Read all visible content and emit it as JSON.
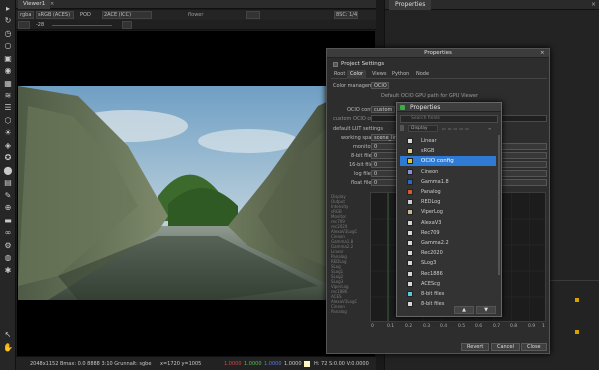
{
  "viewer": {
    "tab_label": "Viewer1",
    "header": {
      "channels": "rgba",
      "colorspace": "sRGB (ACES)",
      "flag": "POD",
      "display": "2ACE (ICC)",
      "frame_mode": "flower",
      "sampling": "8SC: 1/4",
      "gain_value": "-28"
    },
    "footer": {
      "format": "2048x1152 Bmax: 0.0 8888 3:10 Grunnalt: sgbe",
      "coords": "x=1720 y=1005",
      "r": "1.0000",
      "g": "1.0000",
      "b": "1.0000",
      "a": "1.0000",
      "extra": "H: 72 S:0.00 V:0.0000"
    }
  },
  "right_panel": {
    "tab_label": "Properties"
  },
  "properties_window": {
    "title": "Properties",
    "section_title": "Project Settings",
    "tabs": [
      "Root",
      "Color",
      "Views",
      "Python",
      "Node"
    ],
    "active_tab": "Color",
    "fields": {
      "color_management_label": "Color management",
      "color_management_value": "OCIO",
      "ocio_note": "Default OCIO GPU path for GPU Viewer",
      "ocio_config_label": "OCIO config",
      "ocio_config_value": "custom",
      "custom_ocio_label": "custom OCIO config",
      "default_lut_label": "default LUT settings",
      "working_space_label": "working space",
      "working_space_value": "scene_linear",
      "monitor_label": "monitor",
      "monitor_value": "0",
      "8bit_label": "8-bit files",
      "8bit_value": "0",
      "16bit_label": "16-bit files",
      "16bit_value": "0",
      "log_label": "log files",
      "log_value": "0",
      "float_label": "float files",
      "float_value": "0"
    },
    "curve_labels": [
      "Display",
      "Output",
      "Intensity",
      "sRGB",
      "Monitor",
      "rec709",
      "rec2020",
      "AlexaV3LogC",
      "Cineon",
      "Gamma1.8",
      "Gamma2.2",
      "Linear",
      "Panalog",
      "REDLog",
      "SLog",
      "SLog1",
      "SLog2",
      "SLog3",
      "ViperLog",
      "rec1886",
      "ACES",
      "AlexaV3LogC",
      "Cineon",
      "Panalog"
    ],
    "x_axis": [
      "0",
      "0.1",
      "0.2",
      "0.3",
      "0.4",
      "0.5",
      "0.6",
      "0.7",
      "0.8",
      "0.9",
      "1"
    ],
    "buttons": {
      "revert": "Revert",
      "cancel": "Cancel",
      "close": "Close"
    }
  },
  "popup": {
    "title": "Properties",
    "search_placeholder": "Search fields",
    "filter_label": "Display",
    "items": [
      {
        "label": "Linear",
        "color": "#d9d9d9"
      },
      {
        "label": "sRGB",
        "color": "#d9cf8a"
      },
      {
        "label": "OCIO config",
        "color": "#e0c43a"
      },
      {
        "label": "Cineon",
        "color": "#8a8fd4"
      },
      {
        "label": "Gamma1.8",
        "color": "#2a68c4"
      },
      {
        "label": "Panalog",
        "color": "#d45a2a"
      },
      {
        "label": "REDLog",
        "color": "#d0d0d0"
      },
      {
        "label": "ViperLog",
        "color": "#c9b79a"
      },
      {
        "label": "AlexaV3",
        "color": "#d2d2d2"
      },
      {
        "label": "Rec709",
        "color": "#d6d6d6"
      },
      {
        "label": "Gamma2.2",
        "color": "#d6d6d6"
      },
      {
        "label": "Rec2020",
        "color": "#d6d6d6"
      },
      {
        "label": "SLog3",
        "color": "#d6d6d6"
      },
      {
        "label": "Rec1886",
        "color": "#d6d6d6"
      },
      {
        "label": "ACEScg",
        "color": "#d6d6d6"
      },
      {
        "label": "8-bit files",
        "color": "#59c8d6"
      },
      {
        "label": "8-bit files",
        "color": "#d6d6d6"
      }
    ],
    "selected_index": 2
  },
  "icons": [
    "pointer-icon",
    "rotate-icon",
    "clock-icon",
    "circle-icon",
    "square-icon",
    "sphere-icon",
    "grid-icon",
    "layers-icon",
    "list-icon",
    "transform-icon",
    "sun-icon",
    "shield-icon",
    "color-wheel-icon",
    "paint-icon",
    "stack-icon",
    "brush-icon",
    "merge-icon",
    "eraser-icon",
    "link-icon",
    "gear-icon",
    "globe-icon",
    "settings-icon"
  ]
}
